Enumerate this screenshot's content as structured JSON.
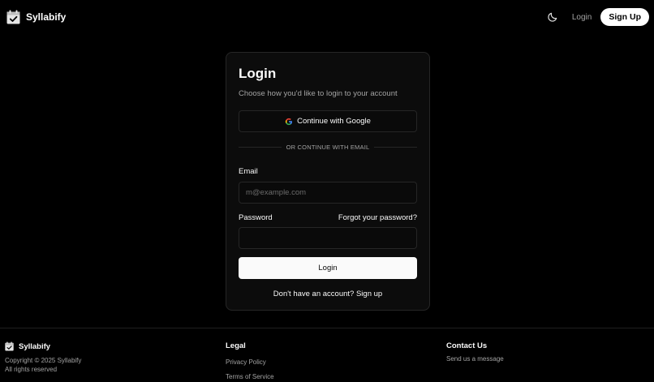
{
  "header": {
    "brand_name": "Syllabify",
    "brand_icon": "calendar-check-icon",
    "theme_icon": "moon-icon",
    "login_label": "Login",
    "signup_label": "Sign Up"
  },
  "login_card": {
    "title": "Login",
    "subtitle": "Choose how you'd like to login to your account",
    "google_button_label": "Continue with Google",
    "divider_text": "OR CONTINUE WITH EMAIL",
    "email_label": "Email",
    "email_placeholder": "m@example.com",
    "email_value": "",
    "password_label": "Password",
    "password_value": "",
    "forgot_password_label": "Forgot your password?",
    "login_button_label": "Login",
    "signup_prompt": "Don't have an account?",
    "signup_link_label": "Sign up"
  },
  "footer": {
    "brand_name": "Syllabify",
    "copyright": "Copyright © 2025 Syllabify",
    "rights": "All rights reserved",
    "legal_heading": "Legal",
    "legal_links": [
      "Privacy Policy",
      "Terms of Service"
    ],
    "contact_heading": "Contact Us",
    "contact_link": "Send us a message"
  },
  "colors": {
    "background": "#000000",
    "card_background": "#0c0c0c",
    "border": "#262626",
    "text_primary": "#fafafa",
    "text_muted": "#a3a3a3",
    "button_primary_bg": "#fafafa",
    "button_primary_text": "#0a0a0a"
  }
}
